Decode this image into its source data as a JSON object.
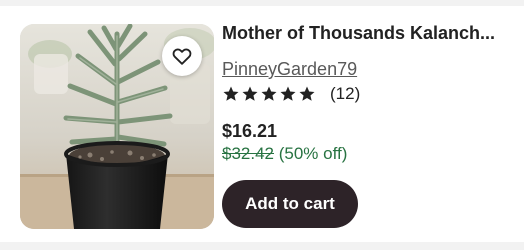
{
  "listing": {
    "title": "Mother of Thousands Kalanch...",
    "shop_name": "PinneyGarden79",
    "rating_stars": 5,
    "review_count": "(12)",
    "price": "$16.21",
    "original_price": "$32.42",
    "discount": "(50% off)",
    "add_to_cart_label": "Add to cart"
  },
  "icons": {
    "favorite": "heart-outline-icon",
    "star": "star-icon"
  },
  "colors": {
    "button_bg": "#2d2328",
    "discount_green": "#287342"
  }
}
